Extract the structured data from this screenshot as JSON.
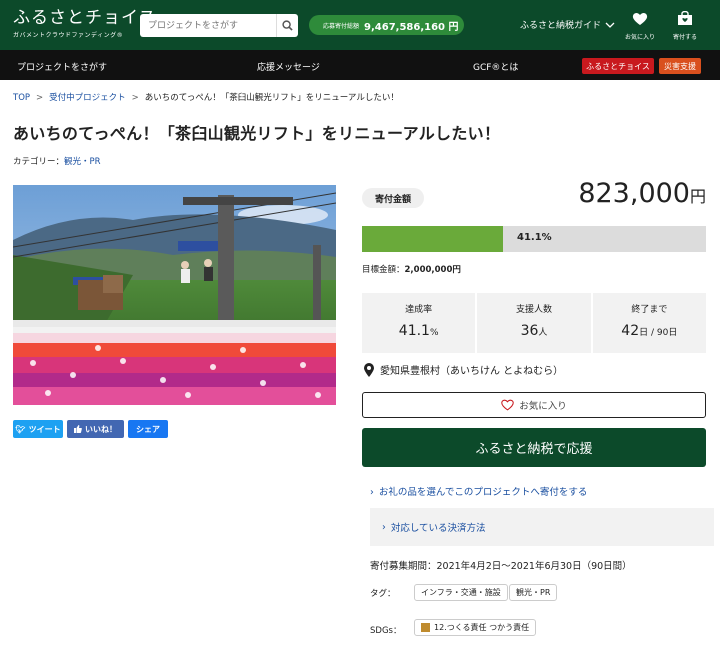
{
  "header": {
    "logo_main": "ふるさとチョイス",
    "logo_sub": "ガバメントクラウドファンディング®",
    "search_placeholder": "プロジェクトをさがす",
    "total_label": "応募寄付総額",
    "total_value": "9,467,586,160 円",
    "guide_label": "ふるさと納税ガイド",
    "fav_label": "お気に入り",
    "donate_label": "寄付する"
  },
  "nav": {
    "items": [
      "プロジェクトをさがす",
      "応援メッセージ",
      "GCF®とは"
    ],
    "btn_furusato": "ふるさとチョイス",
    "btn_disaster": "災害支援"
  },
  "breadcrumb": [
    "TOP",
    "受付中プロジェクト",
    "あいちのてっぺん！「茶臼山観光リフト」をリニューアルしたい！"
  ],
  "project": {
    "title": "あいちのてっぺん！「茶臼山観光リフト」をリニューアルしたい！",
    "category_label": "カテゴリー：",
    "category_value": "観光・PR"
  },
  "share": {
    "tweet": "ツイート",
    "like": "いいね！",
    "share": "シェア"
  },
  "funding": {
    "amount_label": "寄付金額",
    "amount": "823,000",
    "amount_unit": "円",
    "progress": 0.411,
    "progress_text": "41.1%",
    "goal_label": "目標金額：",
    "goal_value": "2,000,000円"
  },
  "stats": [
    {
      "label": "達成率",
      "value": "41.1",
      "unit": "%"
    },
    {
      "label": "支援人数",
      "value": "36",
      "unit": "人"
    },
    {
      "label": "終了まで",
      "value": "42",
      "unit": "日 / 90日"
    }
  ],
  "location": "愛知県豊根村（あいちけん とよねむら）",
  "buttons": {
    "favorite": "お気に入り",
    "support": "ふるさと納税で応援"
  },
  "links": {
    "gift": "お礼の品を選んでこのプロジェクトへ寄付をする",
    "payment": "対応している決済方法"
  },
  "period": "寄付募集期間：2021年4月2日～2021年6月30日（90日間）",
  "tags_label": "タグ：",
  "tags": [
    "インフラ・交通・施設",
    "観光・PR"
  ],
  "sdgs_label": "SDGs：",
  "sdgs": "12.つくる責任 つかう責任",
  "colors": {
    "primary": "#0c4a2a",
    "progress": "#6aaa3a",
    "link": "#1a4fa0",
    "alert": "#c8191e",
    "twitter": "#1da1f2",
    "facebook": "#4267b2"
  }
}
